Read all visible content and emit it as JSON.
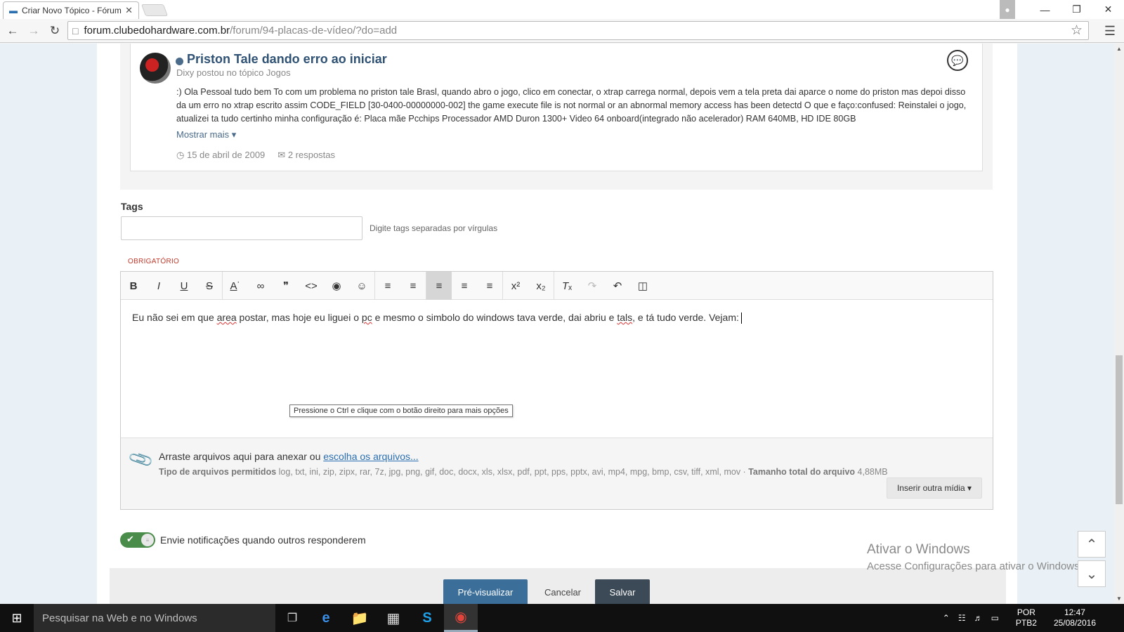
{
  "browser": {
    "tab_title": "Criar Novo Tópico - Fórum",
    "url_host": "forum.clubedohardware.com.br",
    "url_path": "/forum/94-placas-de-vídeo/?do=add"
  },
  "quote": {
    "title": "Priston Tale dando erro ao iniciar",
    "subtitle": "Dixy postou no tópico Jogos",
    "body": ":) Ola Pessoal tudo bem To com um problema no priston tale Brasl, quando abro o jogo, clico em conectar, o xtrap carrega normal, depois vem a tela preta dai aparce o nome do priston mas depoi disso da um erro no xtrap escrito assim CODE_FIELD [30-0400-00000000-002] the game execute file is not normal or an abnormal memory access has been detectd O que e faço:confused: Reinstalei o jogo, atualizei ta tudo certinho minha configuração é: Placa mãe Pcchips Processador AMD Duron 1300+ Video 64 onboard(integrado não acelerador) RAM 640MB, HD IDE 80GB",
    "more": "Mostrar mais",
    "date": "15 de abril de 2009",
    "replies": "2 respostas"
  },
  "tags": {
    "label": "Tags",
    "hint": "Digite tags separadas por vírgulas"
  },
  "required": "OBRIGATÓRIO",
  "editor": {
    "text_1": "Eu não sei em que ",
    "word_area": "area",
    "text_2": " postar, mas hoje eu liguei o ",
    "word_pc": "pc",
    "text_3": " e mesmo o simbolo do windows tava verde, dai abriu e ",
    "word_tals": "tals",
    "text_4": ", e tá tudo verde. Vejam:",
    "tooltip": "Pressione o Ctrl e clique com o botão direito para mais opções"
  },
  "attach": {
    "drag_text": "Arraste arquivos aqui para anexar ou ",
    "choose_link": "escolha os arquivos...",
    "types_label": "Tipo de arquivos permitidos",
    "types": " log, txt, ini, zip, zipx, rar, 7z, jpg, png, gif, doc, docx, xls, xlsx, pdf, ppt, pps, pptx, avi, mp4, mpg, bmp, csv, tiff, xml, mov · ",
    "size_label": "Tamanho total do arquivo",
    "size": " 4,88MB",
    "media_button": "Inserir outra mídia ▾"
  },
  "notify": "Envie notificações quando outros responderem",
  "footer": {
    "preview": "Pré-visualizar",
    "cancel": "Cancelar",
    "save": "Salvar"
  },
  "watermark": {
    "line1": "Ativar o Windows",
    "line2": "Acesse Configurações para ativar o Windows."
  },
  "taskbar": {
    "search_placeholder": "Pesquisar na Web e no Windows",
    "lang_1": "POR",
    "lang_2": "PTB2",
    "time": "12:47",
    "date": "25/08/2016"
  }
}
